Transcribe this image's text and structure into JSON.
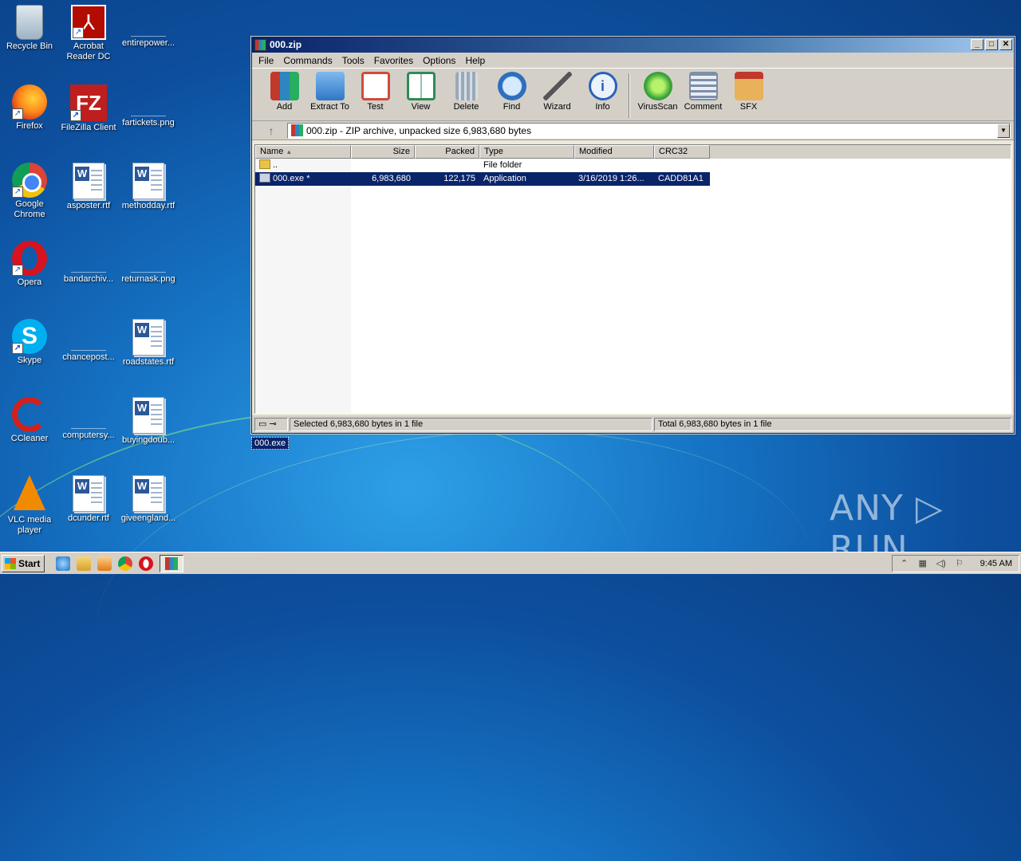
{
  "desktop": {
    "icons": [
      {
        "label": "Recycle Bin"
      },
      {
        "label": "Acrobat Reader DC"
      },
      {
        "label": "entirepower..."
      },
      {
        "label": "Firefox"
      },
      {
        "label": "FileZilla Client"
      },
      {
        "label": "fartickets.png"
      },
      {
        "label": "Google Chrome"
      },
      {
        "label": "asposter.rtf"
      },
      {
        "label": "methodday.rtf"
      },
      {
        "label": "Opera"
      },
      {
        "label": "bandarchiv..."
      },
      {
        "label": "returnask.png"
      },
      {
        "label": "Skype"
      },
      {
        "label": "chancepost..."
      },
      {
        "label": "roadstates.rtf"
      },
      {
        "label": "CCleaner"
      },
      {
        "label": "computersy..."
      },
      {
        "label": "buyingdoub..."
      },
      {
        "label": "VLC media player"
      },
      {
        "label": "dcunder.rtf"
      },
      {
        "label": "giveengland..."
      }
    ],
    "drag_label": "000.exe",
    "watermark": "ANY ▷ RUN"
  },
  "window": {
    "title": "000.zip",
    "controls": {
      "minimize": "_",
      "maximize": "□",
      "close": "✕"
    },
    "menu": [
      "File",
      "Commands",
      "Tools",
      "Favorites",
      "Options",
      "Help"
    ],
    "toolbar": [
      {
        "label": "Add",
        "icon": "add-icon",
        "color": "#c0392b"
      },
      {
        "label": "Extract To",
        "icon": "extract-folder-icon",
        "color": "#3d8fd6"
      },
      {
        "label": "Test",
        "icon": "test-clipboard-icon",
        "color": "#d24a3c"
      },
      {
        "label": "View",
        "icon": "view-book-icon",
        "color": "#2e8b57"
      },
      {
        "label": "Delete",
        "icon": "trash-icon",
        "color": "#8a9aaa"
      },
      {
        "label": "Find",
        "icon": "magnifier-icon",
        "color": "#2c6fbf"
      },
      {
        "label": "Wizard",
        "icon": "wand-icon",
        "color": "#9ab23a"
      },
      {
        "label": "Info",
        "icon": "info-icon",
        "color": "#2a62b8"
      },
      {
        "label": "VirusScan",
        "icon": "virus-scan-icon",
        "color": "#3fa83a"
      },
      {
        "label": "Comment",
        "icon": "comment-icon",
        "color": "#7d8ea8"
      },
      {
        "label": "SFX",
        "icon": "sfx-box-icon",
        "color": "#d9962b"
      }
    ],
    "address": "000.zip - ZIP archive, unpacked size 6,983,680 bytes",
    "columns": [
      "Name",
      "Size",
      "Packed",
      "Type",
      "Modified",
      "CRC32"
    ],
    "rows": [
      {
        "name": "..",
        "size": "",
        "packed": "",
        "type": "File folder",
        "modified": "",
        "crc": "",
        "selected": false
      },
      {
        "name": "000.exe *",
        "size": "6,983,680",
        "packed": "122,175",
        "type": "Application",
        "modified": "3/16/2019 1:26...",
        "crc": "CADD81A1",
        "selected": true
      }
    ],
    "status_left": "Selected 6,983,680 bytes in 1 file",
    "status_right": "Total 6,983,680 bytes in 1 file"
  },
  "taskbar": {
    "start": "Start",
    "clock": "9:45 AM"
  }
}
